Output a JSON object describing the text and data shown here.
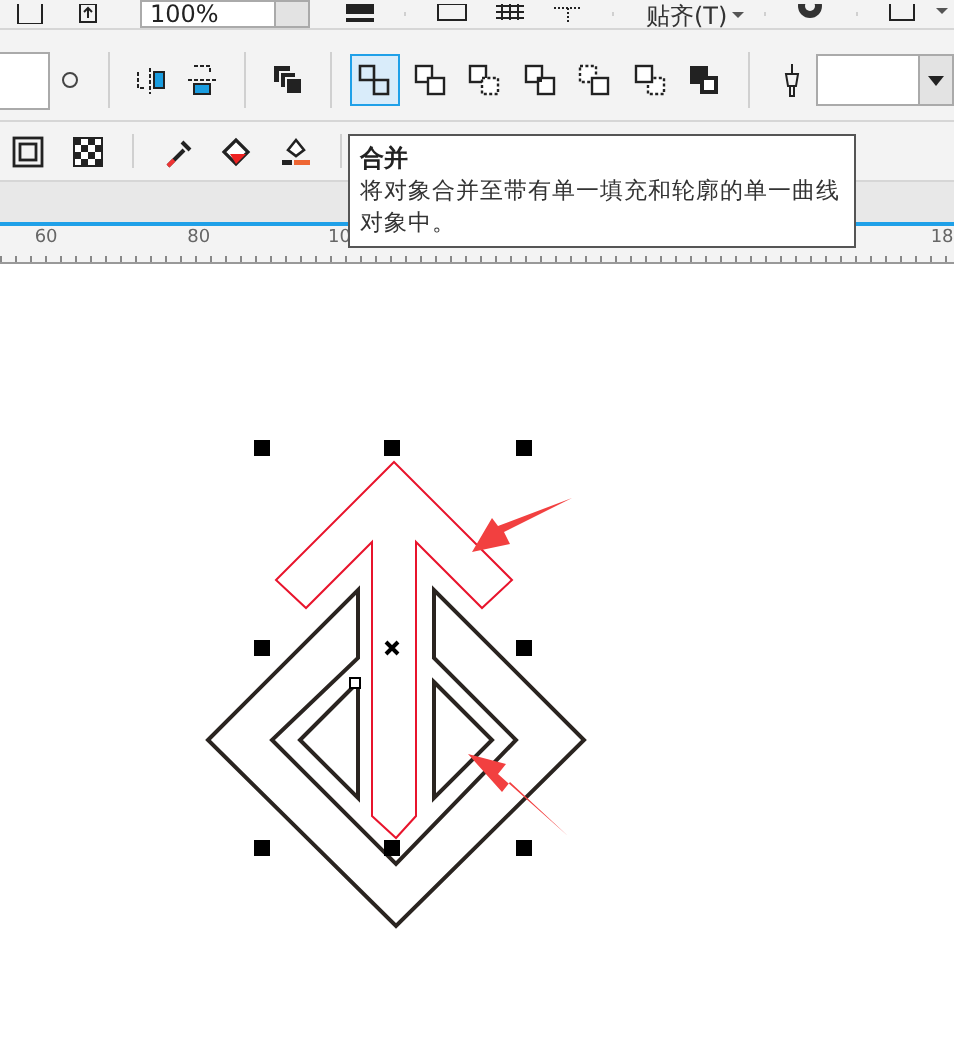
{
  "top_toolbar": {
    "zoom_field": {
      "value": "100%"
    },
    "snap_menu": {
      "label": "贴齐(T)"
    }
  },
  "property_bar": {
    "shape_buttons": [
      {
        "selected": true
      },
      {
        "selected": false
      },
      {
        "selected": false
      },
      {
        "selected": false
      },
      {
        "selected": false
      },
      {
        "selected": false
      },
      {
        "selected": false
      }
    ]
  },
  "tooltip": {
    "title": "合并",
    "body": "将对象合并至带有单一填充和轮廓的单一曲线对象中。"
  },
  "ruler": {
    "labels": [
      "60",
      "80",
      "10",
      "18"
    ]
  }
}
